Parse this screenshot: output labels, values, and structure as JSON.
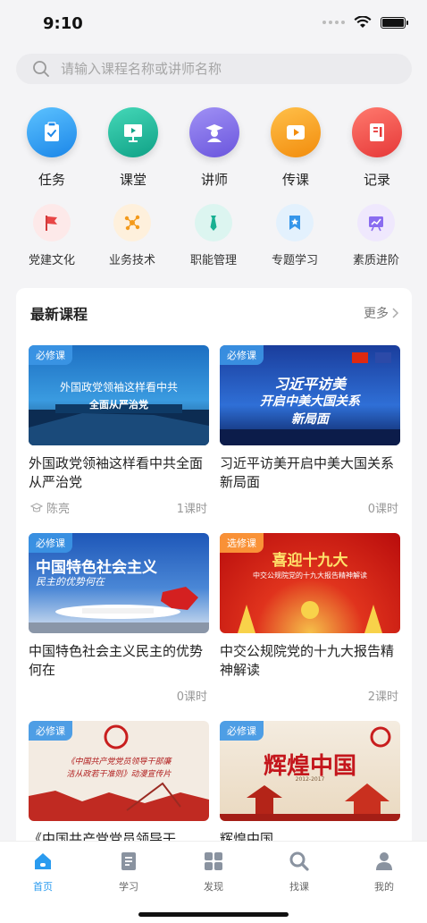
{
  "status": {
    "time": "9:10"
  },
  "search": {
    "placeholder": "请输入课程名称或讲师名称"
  },
  "main_nav": [
    {
      "label": "任务",
      "icon": "clipboard-check-icon",
      "color": "#2a9cf0"
    },
    {
      "label": "课堂",
      "icon": "presentation-board-icon",
      "color": "#1fb39a"
    },
    {
      "label": "讲师",
      "icon": "graduate-teacher-icon",
      "color": "#7c6de8"
    },
    {
      "label": "传课",
      "icon": "video-play-icon",
      "color": "#f5a01a"
    },
    {
      "label": "记录",
      "icon": "notebook-record-icon",
      "color": "#f04848"
    }
  ],
  "sub_nav": [
    {
      "label": "党建文化",
      "icon": "flag-icon",
      "color": "#fde9e9"
    },
    {
      "label": "业务技术",
      "icon": "network-nodes-icon",
      "color": "#fef0dc"
    },
    {
      "label": "职能管理",
      "icon": "tie-icon",
      "color": "#dcf5f0"
    },
    {
      "label": "专题学习",
      "icon": "star-badge-icon",
      "color": "#e3f1fd"
    },
    {
      "label": "素质进阶",
      "icon": "growth-chart-icon",
      "color": "#efe8fd"
    }
  ],
  "latest": {
    "title": "最新课程",
    "more": "更多",
    "courses": [
      {
        "tag": "必修课",
        "thumb_text": "外国政党领袖这样看中共",
        "thumb_sub": "全面从严治党",
        "title": "外国政党领袖这样看中共全面从严治党",
        "teacher": "陈亮",
        "hours": "1课时"
      },
      {
        "tag": "必修课",
        "thumb_text": "习近平访美",
        "thumb_sub": "开启中美大国关系",
        "thumb_sub2": "新局面",
        "title": "习近平访美开启中美大国关系新局面",
        "teacher": "",
        "hours": "0课时"
      },
      {
        "tag": "必修课",
        "thumb_text": "中国特色社会主义",
        "thumb_sub": "民主的优势何在",
        "title": "中国特色社会主义民主的优势何在",
        "teacher": "",
        "hours": "0课时"
      },
      {
        "tag": "选修课",
        "thumb_text": "喜迎十九大",
        "thumb_sub": "中交公规院党的十九大报告精神解读",
        "title": "中交公规院党的十九大报告精神解读",
        "teacher": "",
        "hours": "2课时"
      },
      {
        "tag": "必修课",
        "thumb_text": "《中国共产党党员领导干部廉",
        "thumb_sub": "洁从政若干准则》动漫宣传片",
        "title": "《中国共产党党员领导干",
        "teacher": "",
        "hours": ""
      },
      {
        "tag": "必修课",
        "thumb_text": "辉煌中国",
        "thumb_sub": "2012-2017",
        "title": "辉煌中国",
        "teacher": "",
        "hours": ""
      }
    ]
  },
  "tabs": [
    {
      "label": "首页",
      "icon": "home-icon",
      "active": true
    },
    {
      "label": "学习",
      "icon": "document-icon",
      "active": false
    },
    {
      "label": "发现",
      "icon": "grid-icon",
      "active": false
    },
    {
      "label": "找课",
      "icon": "search-icon",
      "active": false
    },
    {
      "label": "我的",
      "icon": "user-icon",
      "active": false
    }
  ],
  "colors": {
    "accent": "#2a9bef",
    "background": "#f4f4f6"
  }
}
